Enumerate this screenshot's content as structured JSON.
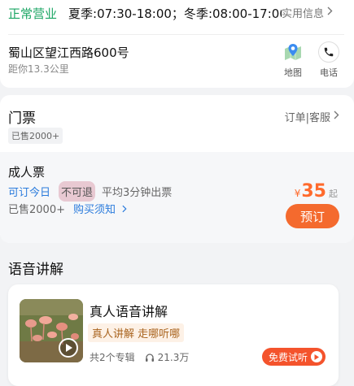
{
  "info": {
    "status": "正常营业",
    "hours": "夏季:07:30-18:00；冬季:08:00-17:00",
    "more_label": "实用信息",
    "address": "蜀山区望江西路600号",
    "distance": "距你13.3公里",
    "map_label": "地图",
    "phone_label": "电话"
  },
  "tickets": {
    "title": "门票",
    "sold_total": "已售2000+",
    "order_link": "订单|客服",
    "item": {
      "name": "成人票",
      "tag_today": "可订今日",
      "tag_norefund": "不可退",
      "tag_time": "平均3分钟出票",
      "sold": "已售2000+",
      "notice": "购买须知",
      "currency": "¥",
      "price": "35",
      "price_suffix": "起",
      "book_label": "预订"
    }
  },
  "audio": {
    "section_title": "语音讲解",
    "card_title": "真人语音讲解",
    "tags": "真人讲解 走哪听哪",
    "albums": "共2个专辑",
    "plays": "21.3万",
    "trial_label": "免费试听"
  },
  "colors": {
    "accent": "#f46a2e",
    "link": "#2a7bdc",
    "open_green": "#1aa563",
    "trial_red": "#f4532c"
  }
}
